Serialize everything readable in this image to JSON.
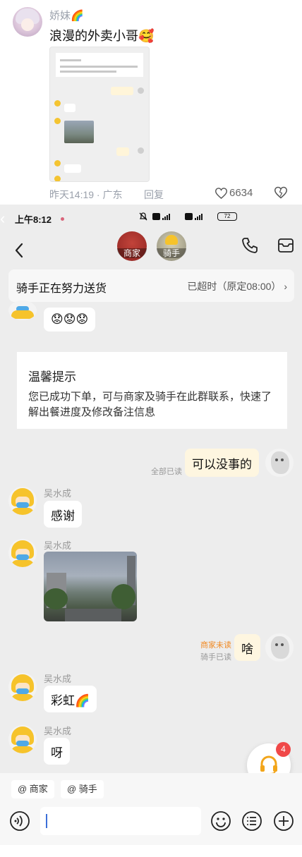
{
  "comment": {
    "user_name": "娇妹🌈",
    "text": "浪漫的外卖小哥🥰",
    "time_location": "昨天14:19 · 广东",
    "reply_label": "回复",
    "like_count": "6634"
  },
  "status_bar": {
    "time": "上午8:12",
    "battery": "72"
  },
  "chat_header": {
    "merchant_label": "商家",
    "rider_label": "骑手"
  },
  "delivery_banner": {
    "status": "骑手正在努力送货",
    "eta": "已超时（原定08:00）"
  },
  "partial_emoji": "😟😟😟",
  "notice": {
    "title": "温馨提示",
    "body": "您已成功下单，可与商家及骑手在此群联系，快速了解出餐进度及修改备注信息"
  },
  "messages": [
    {
      "sender": "",
      "text": "可以没事的",
      "from_me": true,
      "read_status": "全部已读"
    },
    {
      "sender": "吴水成",
      "text": "感谢",
      "from_me": false
    },
    {
      "sender": "吴水成",
      "text": "",
      "type": "image",
      "from_me": false
    },
    {
      "sender": "",
      "text": "啥",
      "from_me": true,
      "read_status_1": "商家未读",
      "read_status_2": "骑手已读"
    },
    {
      "sender": "吴水成",
      "text": "彩虹🌈",
      "from_me": false
    },
    {
      "sender": "吴水成",
      "text": "呀",
      "from_me": false
    }
  ],
  "support_badge": "4",
  "quick_mentions": [
    "@ 商家",
    "@ 骑手"
  ],
  "colors": {
    "chat_bg": "#ededed",
    "my_bubble": "#fef6e0",
    "badge_red": "#f04848",
    "unread_orange": "#f08a24",
    "rider_yellow": "#f6c32b"
  },
  "icons": {
    "voice": "voice-icon",
    "emoji": "emoji-icon",
    "list": "list-icon",
    "add": "add-icon",
    "phone": "phone-icon",
    "order": "order-box-icon",
    "back": "back-arrow-icon",
    "support": "headset-icon"
  }
}
